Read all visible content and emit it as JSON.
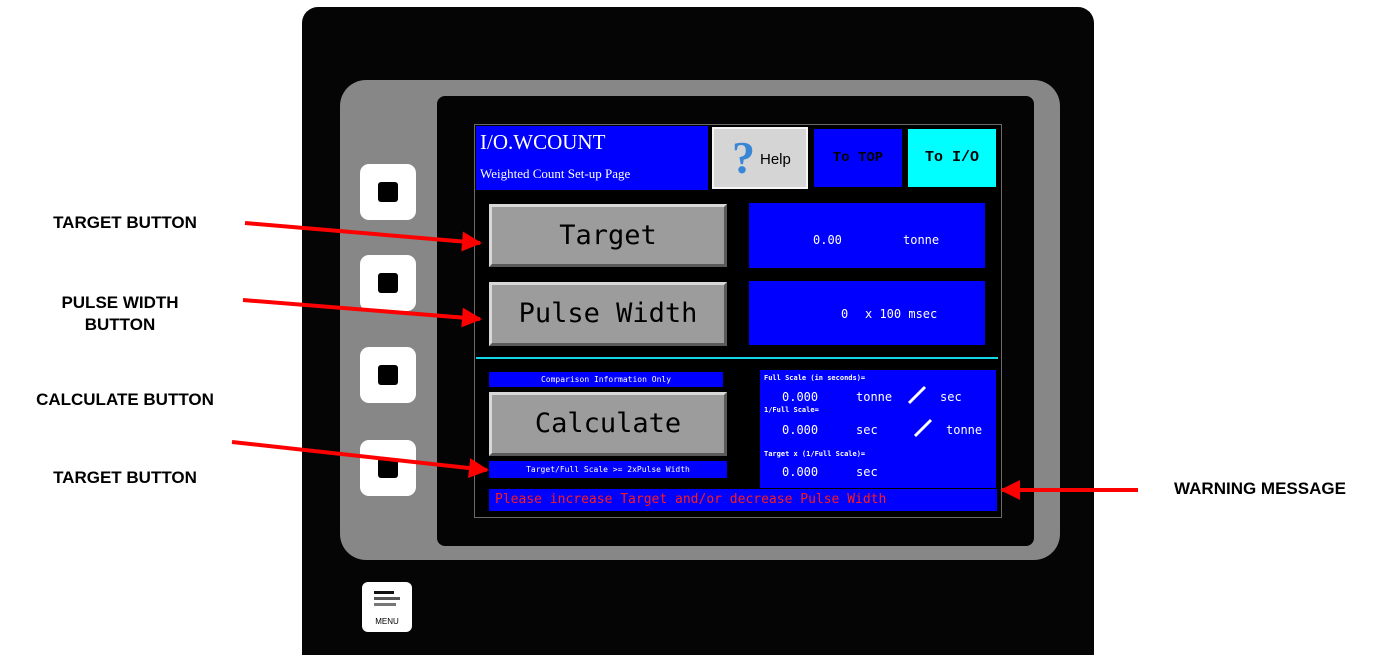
{
  "annotations": {
    "target_button": "TARGET BUTTON",
    "pulse_width_button": "PULSE WIDTH BUTTON",
    "calculate_button": "CALCULATE BUTTON",
    "target_button_2": "TARGET BUTTON",
    "warning_message": "WARNING MESSAGE"
  },
  "header": {
    "title": "I/O.WCOUNT",
    "subtitle": "Weighted Count Set-up Page",
    "help_label": "Help",
    "to_top_label": "To TOP",
    "to_io_label": "To I/O"
  },
  "target": {
    "button_label": "Target",
    "value": "0.00",
    "unit": "tonne"
  },
  "pulse_width": {
    "button_label": "Pulse Width",
    "value": "0",
    "unit": "x 100 msec"
  },
  "comparison": {
    "header": "Comparison Information Only",
    "calculate_label": "Calculate",
    "condition": "Target/Full Scale >= 2xPulse Width",
    "full_scale_label": "Full Scale (in seconds)=",
    "full_scale_value": "0.000",
    "full_scale_unit_a": "tonne",
    "full_scale_unit_b": "sec",
    "inverse_label": "1/Full Scale=",
    "inverse_value": "0.000",
    "inverse_unit_a": "sec",
    "inverse_unit_b": "tonne",
    "product_label": "Target x (1/Full Scale)=",
    "product_value": "0.000",
    "product_unit": "sec"
  },
  "warning": {
    "text": "Please increase Target and/or decrease Pulse Width",
    "color": "#ff1a1a"
  },
  "menu_key_label": "MENU",
  "colors": {
    "screen_blue": "#0000ff",
    "cyan": "#00ffff",
    "arrow_red": "#ff0000"
  }
}
